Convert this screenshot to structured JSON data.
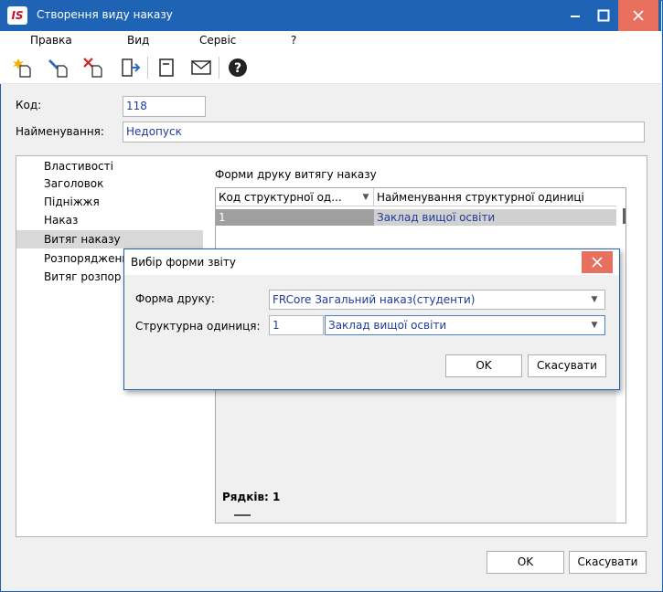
{
  "window": {
    "app_logo": "IS",
    "title": "Створення виду наказу"
  },
  "menu": [
    "Правка",
    "Вид",
    "Сервіс",
    "?"
  ],
  "toolbar_icons": [
    "new-icon",
    "edit-icon",
    "delete-icon",
    "exit-icon",
    "document-icon",
    "mail-icon",
    "help-icon"
  ],
  "form": {
    "code_label": "Код:",
    "code_value": "118",
    "name_label": "Найменування:",
    "name_value": "Недопуск"
  },
  "nav": {
    "items": [
      "Властивості",
      "Заголовок",
      "Підніжжя",
      "Наказ",
      "Витяг наказу",
      "Розпорядженн",
      "Витяг розпор"
    ],
    "selected_index": 4
  },
  "print_forms": {
    "title": "Форми друку витягу наказу",
    "columns": [
      "Код структурної од...",
      "Найменування структурної одиниці"
    ],
    "rows": [
      {
        "code": "1",
        "name": "Заклад вищої освіти"
      }
    ],
    "rows_label": "Рядків: 1"
  },
  "dialog": {
    "title": "Вибір форми звіту",
    "print_form_label": "Форма друку:",
    "print_form_value": "FRCore Загальний наказ(студенти)",
    "unit_label": "Структурна одиниця:",
    "unit_code": "1",
    "unit_name": "Заклад вищої освіти",
    "ok": "OK",
    "cancel": "Скасувати"
  },
  "footer": {
    "ok": "OK",
    "cancel": "Скасувати"
  },
  "colors": {
    "titlebar": "#1f64b4",
    "close": "#e8705f",
    "field_text": "#1f3b9a"
  }
}
